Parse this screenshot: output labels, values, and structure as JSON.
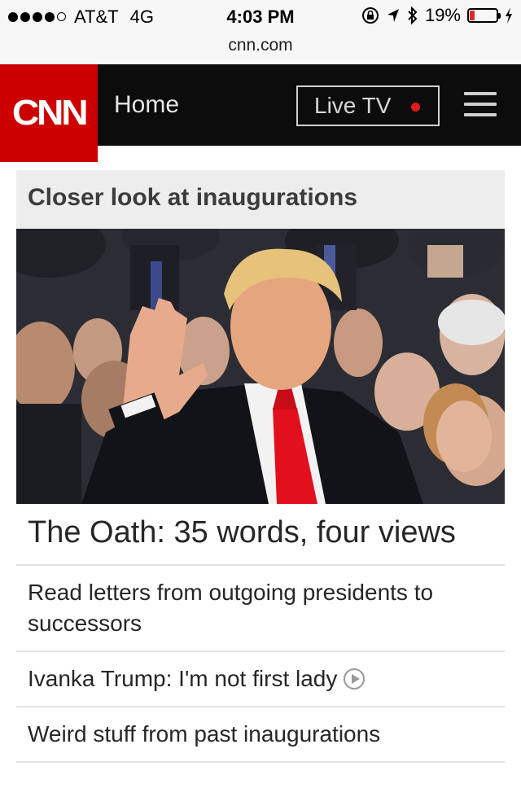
{
  "status_bar": {
    "carrier": "AT&T",
    "network": "4G",
    "time": "4:03 PM",
    "battery": "19%",
    "battery_level": 0.19,
    "signal_dots_filled": 4,
    "signal_dots_total": 5,
    "icons": [
      "rotation-lock-icon",
      "location-arrow-icon",
      "bluetooth-icon",
      "charging-bolt-icon"
    ]
  },
  "url_bar": {
    "url": "cnn.com"
  },
  "header": {
    "logo": "CNN",
    "home_label": "Home",
    "live_tv_label": "Live TV",
    "menu_icon": "hamburger-menu-icon",
    "colors": {
      "brand_red": "#cc0000",
      "bar": "#0c0c0c",
      "live_dot": "#e41a1a"
    }
  },
  "section": {
    "title": "Closer look at inaugurations",
    "hero_image_alt": "man-raising-hand-taking-oath",
    "headline": "The Oath: 35 words, four views",
    "stories": [
      {
        "title": "Read letters from outgoing presidents to successors",
        "has_video": false
      },
      {
        "title": "Ivanka Trump: I'm not first lady",
        "has_video": true
      },
      {
        "title": "Weird stuff from past inaugurations",
        "has_video": false
      }
    ]
  }
}
